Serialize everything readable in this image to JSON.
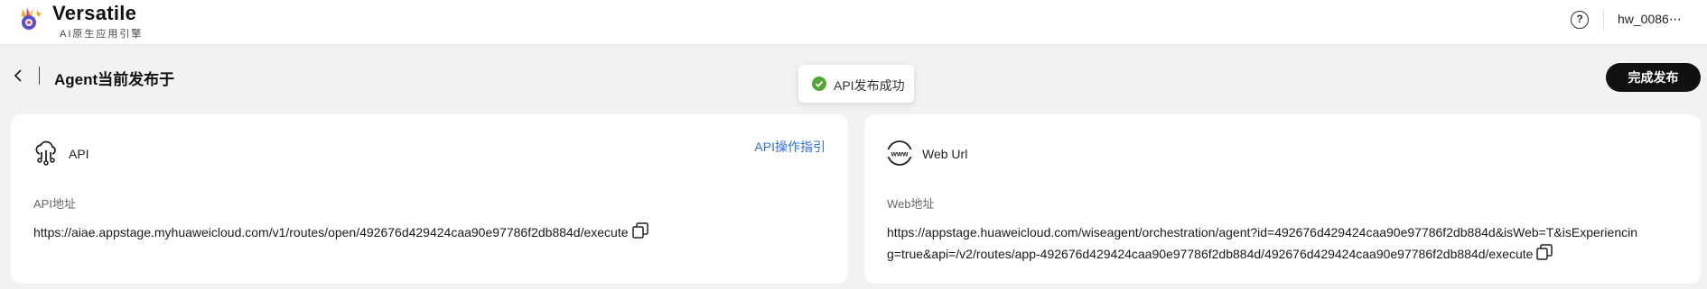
{
  "header": {
    "brand_name": "Versatile",
    "brand_subtitle": "AI原生应用引擎",
    "logo_icon": "versatile-logo",
    "help_icon": "question-circle-icon",
    "help_symbol": "?",
    "username": "hw_0086⋯"
  },
  "page": {
    "back_icon": "chevron-left-icon",
    "title": "Agent当前发布于"
  },
  "toast": {
    "icon": "check-circle-icon",
    "text": "API发布成功",
    "icon_color": "#52a832"
  },
  "actions": {
    "publish_label": "完成发布"
  },
  "api_card": {
    "icon": "cloud-api-icon",
    "title": "API",
    "guide_link": "API操作指引",
    "address_label": "API地址",
    "address_value": "https://aiae.appstage.myhuaweicloud.com/v1/routes/open/492676d429424caa90e97786f2db884d/execute",
    "copy_icon": "copy-icon"
  },
  "web_card": {
    "icon": "www-globe-icon",
    "title": "Web Url",
    "address_label": "Web地址",
    "address_line1": "https://appstage.huaweicloud.com/wiseagent/orchestration/agent?id=492676d429424caa90e97786f2db884d&isWeb=T&isExperiencin",
    "address_line2": "g=true&api=/v2/routes/app-492676d429424caa90e97786f2db884d/492676d429424caa90e97786f2db884d/execute",
    "copy_icon": "copy-icon"
  },
  "colors": {
    "link": "#2f6ee8",
    "primary_button": "#111111",
    "background": "#f2f2f3"
  }
}
